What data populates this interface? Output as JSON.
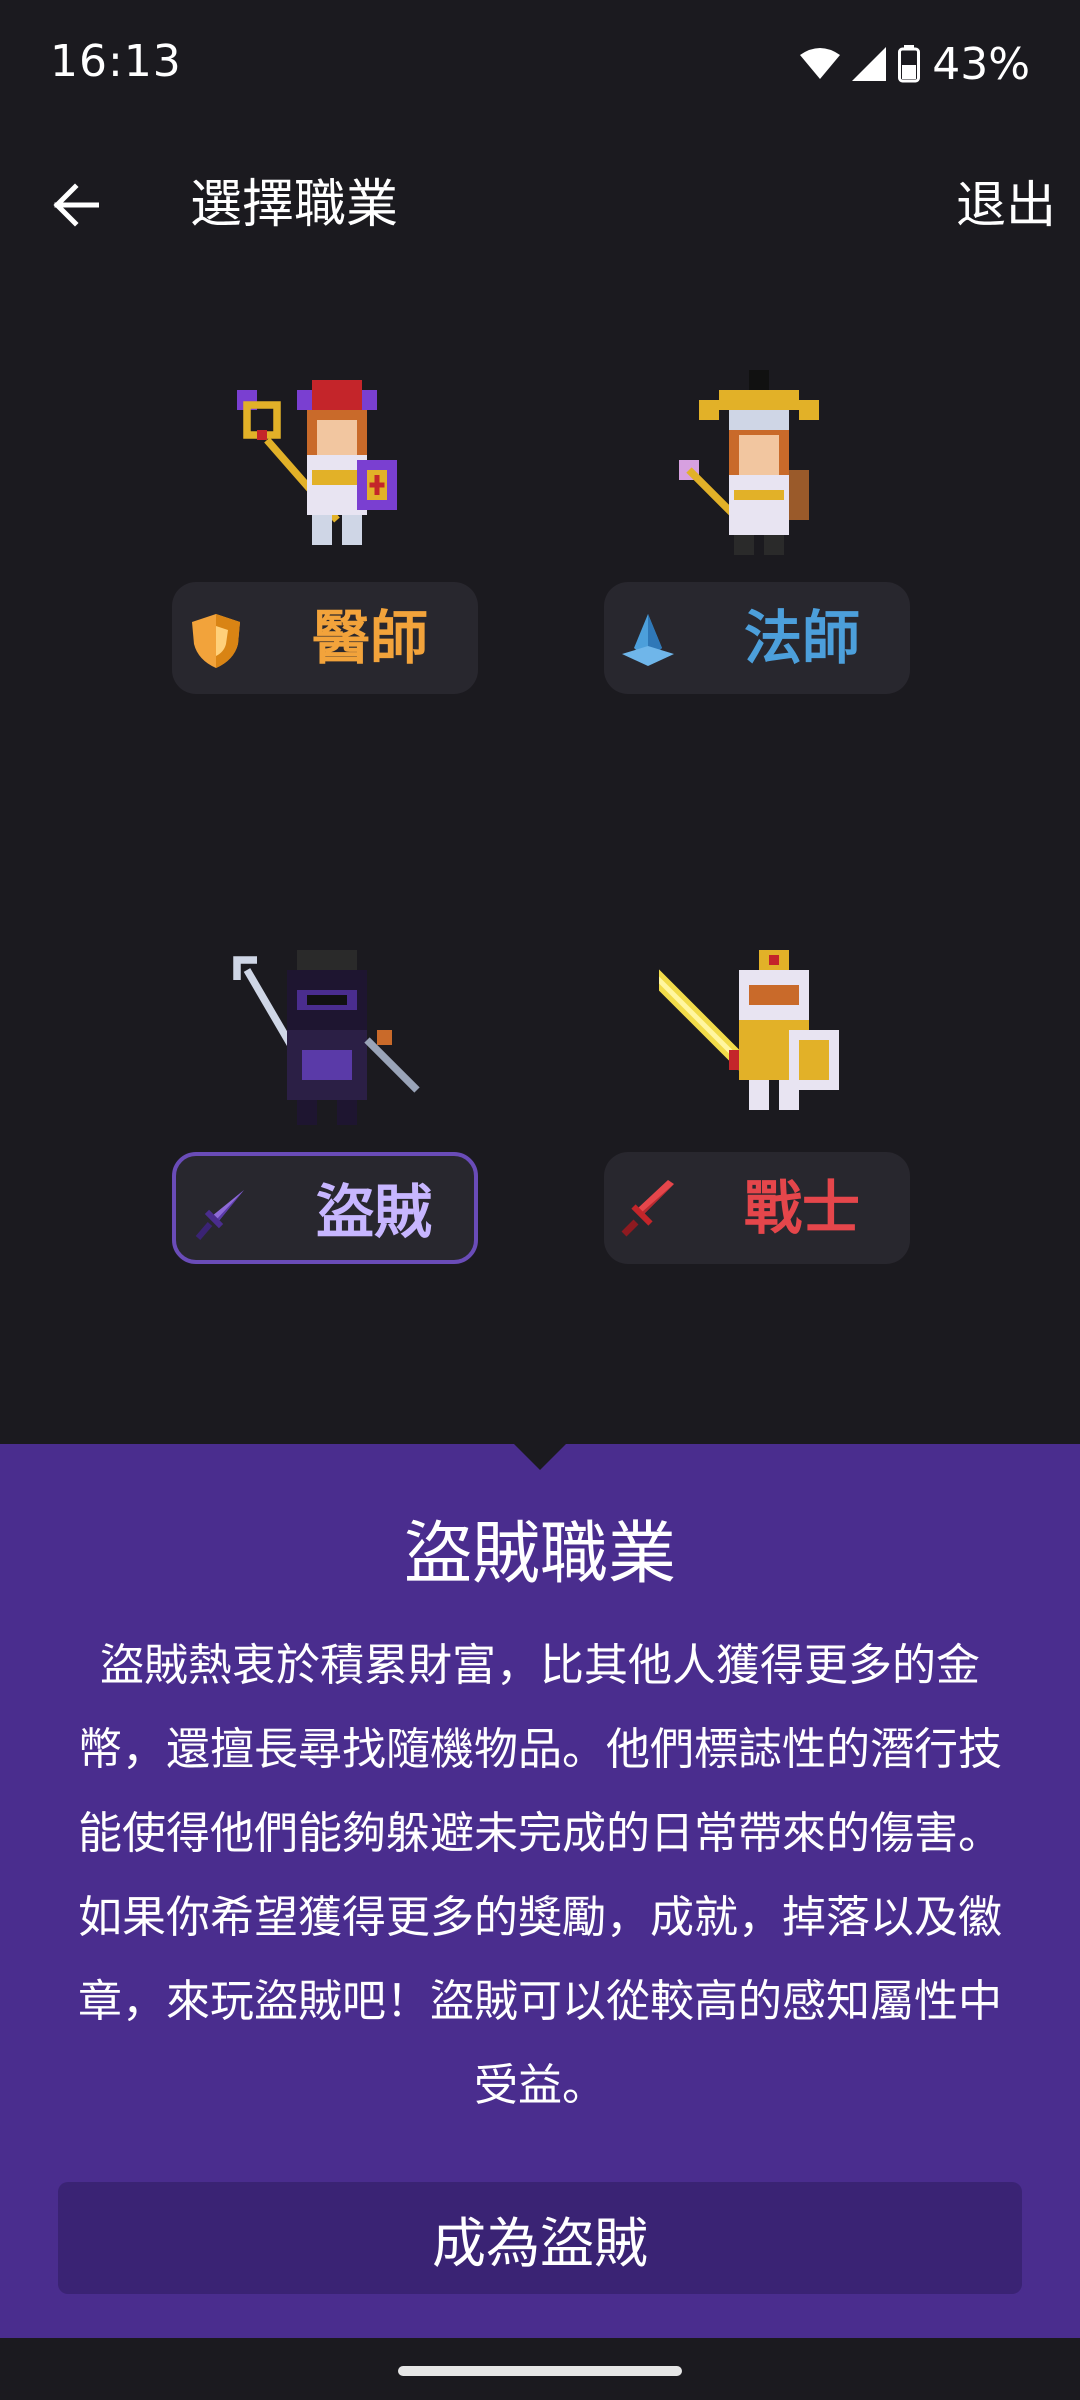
{
  "status_bar": {
    "time": "16:13",
    "battery": "43%"
  },
  "app_bar": {
    "title": "選擇職業",
    "exit_label": "退出"
  },
  "classes": [
    {
      "label": "醫師",
      "color": "#f2a33b",
      "icon": "shield-icon"
    },
    {
      "label": "法師",
      "color": "#4c9fdb",
      "icon": "crystal-icon"
    },
    {
      "label": "盜賊",
      "color": "#c7b6ff",
      "icon": "dagger-icon",
      "selected": true
    },
    {
      "label": "戰士",
      "color": "#e5464b",
      "icon": "sword-icon"
    }
  ],
  "panel": {
    "title": "盜賊職業",
    "description": "盜賊熱衷於積累財富，比其他人獲得更多的金幣，還擅長尋找隨機物品。他們標誌性的潛行技能使得他們能夠躲避未完成的日常帶來的傷害。如果你希望獲得更多的獎勵，成就，掉落以及徽章，來玩盜賊吧！盜賊可以從較高的感知屬性中受益。",
    "button_label": "成為盜賊"
  },
  "colors": {
    "background": "#1b1a1f",
    "panel": "#4a2d8e",
    "button": "#3a2374"
  }
}
